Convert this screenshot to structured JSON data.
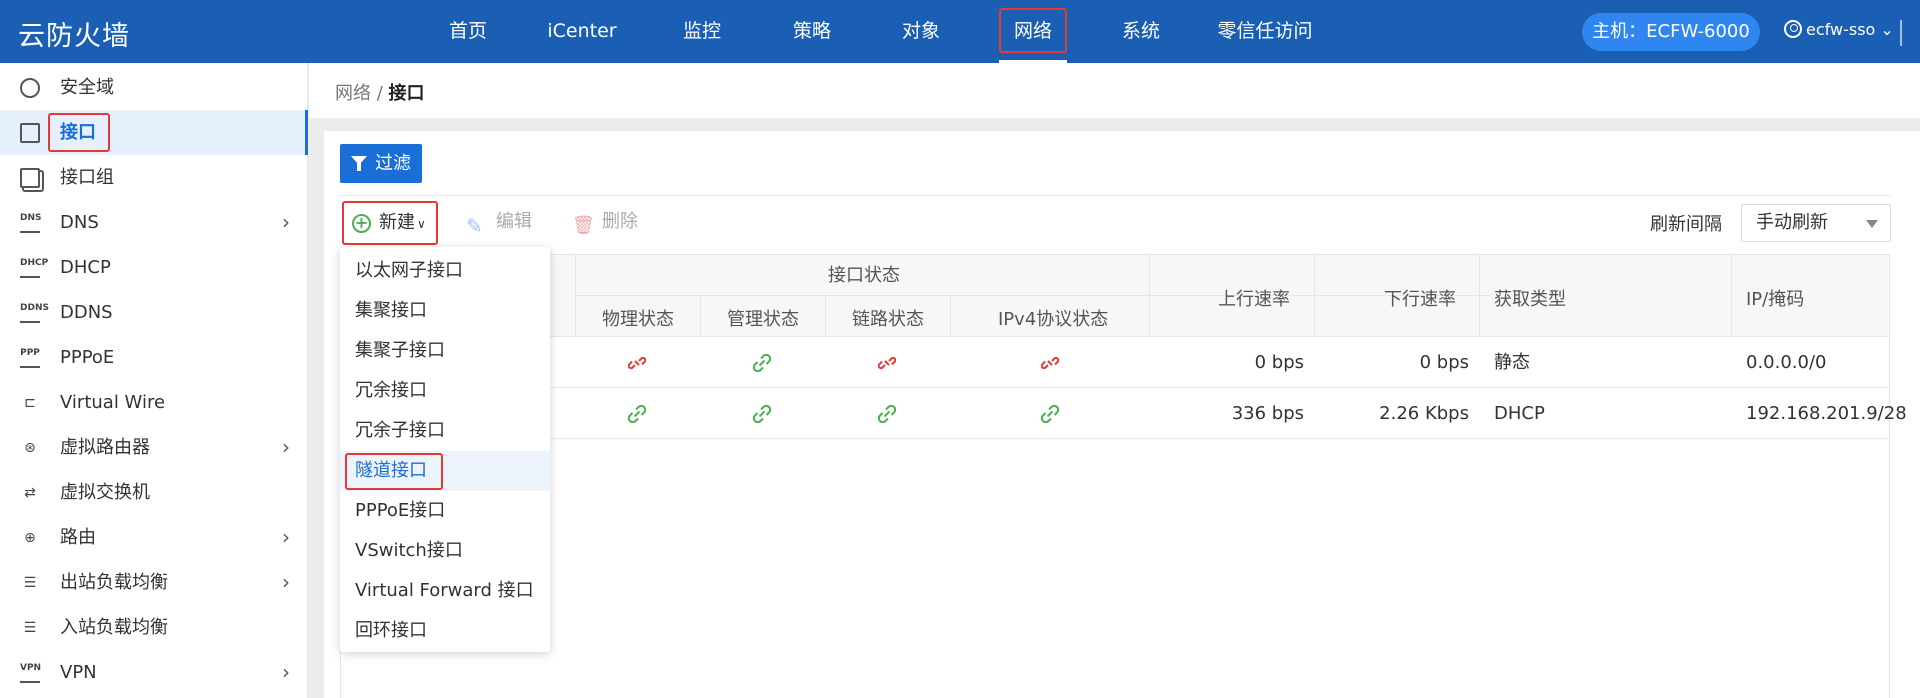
{
  "topbar": {
    "brand": "云防火墙",
    "nav": [
      "首页",
      "iCenter",
      "监控",
      "策略",
      "对象",
      "网络",
      "系统",
      "零信任访问"
    ],
    "active_nav": "网络",
    "host": "主机：ECFW-6000",
    "user": "ecfw-sso",
    "user_chevron": "⌄"
  },
  "sidebar": {
    "items": [
      {
        "label": "安全域",
        "icon": "shield-icon"
      },
      {
        "label": "接口",
        "icon": "interface-icon"
      },
      {
        "label": "接口组",
        "icon": "interface-group-icon"
      },
      {
        "label": "DNS",
        "icon": "dns-icon",
        "has_children": true
      },
      {
        "label": "DHCP",
        "icon": "dhcp-icon"
      },
      {
        "label": "DDNS",
        "icon": "ddns-icon"
      },
      {
        "label": "PPPoE",
        "icon": "pppoe-icon"
      },
      {
        "label": "Virtual Wire",
        "icon": "virtual-wire-icon"
      },
      {
        "label": "虚拟路由器",
        "icon": "virtual-router-icon",
        "has_children": true
      },
      {
        "label": "虚拟交换机",
        "icon": "virtual-switch-icon"
      },
      {
        "label": "路由",
        "icon": "route-icon",
        "has_children": true
      },
      {
        "label": "出站负载均衡",
        "icon": "outbound-lb-icon",
        "has_children": true
      },
      {
        "label": "入站负载均衡",
        "icon": "inbound-lb-icon"
      },
      {
        "label": "VPN",
        "icon": "vpn-icon",
        "has_children": true
      }
    ],
    "icon_glyphs": {
      "dns": "DNS",
      "dhcp": "DHCP",
      "ddns": "DDNS",
      "pppoe": "PPP",
      "vpn": "VPN"
    },
    "arrow": "›"
  },
  "breadcrumb": {
    "parent": "网络 / ",
    "current": "接口"
  },
  "toolbar": {
    "filter": "过滤",
    "new": "新建",
    "edit": "编辑",
    "delete": "删除",
    "refresh_label": "刷新间隔",
    "refresh_value": "手动刷新"
  },
  "table": {
    "group_header": "接口状态",
    "sub_headers": [
      "物理状态",
      "管理状态",
      "链路状态",
      "IPv4协议状态"
    ],
    "columns": [
      "上行速率",
      "下行速率",
      "获取类型",
      "IP/掩码"
    ],
    "rows": [
      {
        "status": [
          "down",
          "up",
          "down",
          "down"
        ],
        "up_rate": "0 bps",
        "down_rate": "0 bps",
        "type": "静态",
        "ip": "0.0.0.0/0"
      },
      {
        "status": [
          "up",
          "up",
          "up",
          "up"
        ],
        "up_rate": "336 bps",
        "down_rate": "2.26 Kbps",
        "type": "DHCP",
        "ip": "192.168.201.9/28"
      }
    ]
  },
  "new_menu": {
    "items": [
      "以太网子接口",
      "集聚接口",
      "集聚子接口",
      "冗余接口",
      "冗余子接口",
      "隧道接口",
      "PPPoE接口",
      "VSwitch接口",
      "Virtual Forward 接口",
      "回环接口"
    ],
    "highlighted": "隧道接口"
  },
  "colors": {
    "primary": "#1a5fb4",
    "accent": "#1a6fd6",
    "link_up": "#4caf50",
    "link_down": "#e53935",
    "highlight_box": "#e53935"
  }
}
